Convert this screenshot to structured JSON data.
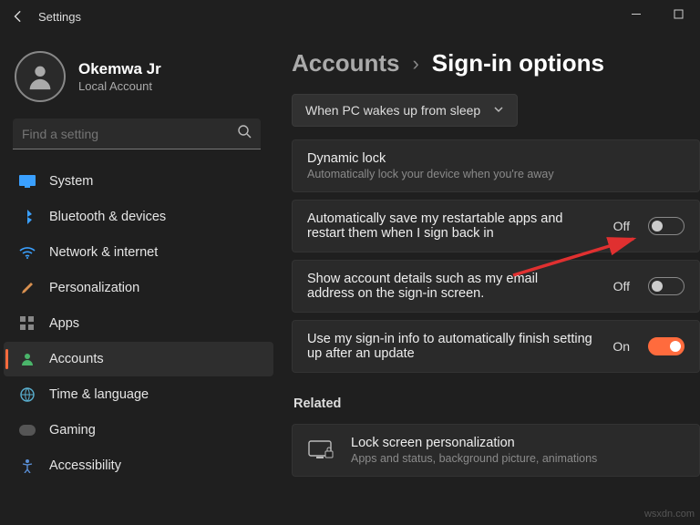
{
  "window": {
    "title": "Settings"
  },
  "user": {
    "name": "Okemwa Jr",
    "type": "Local Account"
  },
  "search": {
    "placeholder": "Find a setting"
  },
  "nav": {
    "system": "System",
    "bluetooth": "Bluetooth & devices",
    "network": "Network & internet",
    "personalization": "Personalization",
    "apps": "Apps",
    "accounts": "Accounts",
    "time": "Time & language",
    "gaming": "Gaming",
    "accessibility": "Accessibility"
  },
  "breadcrumb": {
    "root": "Accounts",
    "page": "Sign-in options"
  },
  "dropdown": {
    "label": "When PC wakes up from sleep"
  },
  "rows": {
    "dynamiclock": {
      "title": "Dynamic lock",
      "sub": "Automatically lock your device when you're away"
    },
    "restartable": {
      "title": "Automatically save my restartable apps and restart them when I sign back in",
      "state": "Off"
    },
    "accountdetails": {
      "title": "Show account details such as my email address on the sign-in screen.",
      "state": "Off"
    },
    "signininfo": {
      "title": "Use my sign-in info to automatically finish setting up after an update",
      "state": "On"
    }
  },
  "related": {
    "heading": "Related",
    "lockscreen": {
      "title": "Lock screen personalization",
      "sub": "Apps and status, background picture, animations"
    }
  },
  "watermark": "wsxdn.com"
}
